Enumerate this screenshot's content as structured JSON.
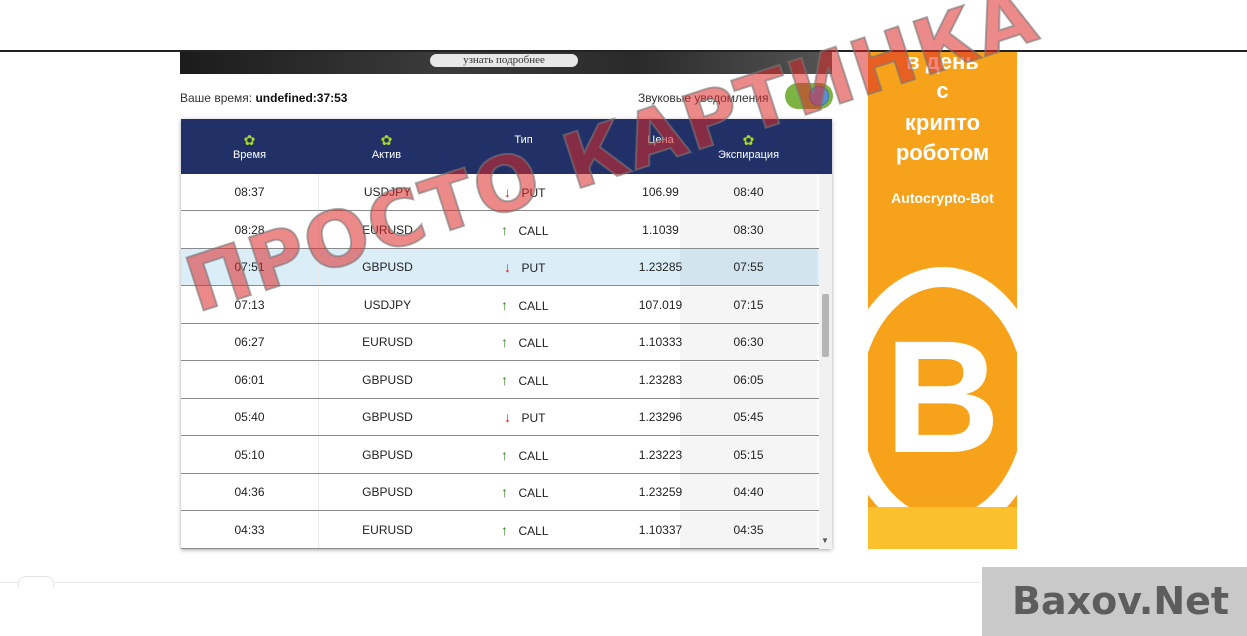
{
  "banner": {
    "button_label": "узнать подробнее"
  },
  "status": {
    "time_prefix": "Ваше время:",
    "time_value": "undefined:37:53",
    "sound_label": "Звуковые уведомления",
    "sound_enabled": true
  },
  "table": {
    "headers": [
      {
        "label": "Время",
        "icon": "gear-icon"
      },
      {
        "label": "Актив",
        "icon": "gear-icon"
      },
      {
        "label": "Тип",
        "icon": ""
      },
      {
        "label": "Цена",
        "icon": ""
      },
      {
        "label": "Экспирация",
        "icon": "gear-icon"
      }
    ],
    "rows": [
      {
        "time": "08:37",
        "asset": "USDJPY",
        "type": "PUT",
        "price": "106.99",
        "expiration": "08:40"
      },
      {
        "time": "08:28",
        "asset": "EURUSD",
        "type": "CALL",
        "price": "1.1039",
        "expiration": "08:30"
      },
      {
        "time": "07:51",
        "asset": "GBPUSD",
        "type": "PUT",
        "price": "1.23285",
        "expiration": "07:55"
      },
      {
        "time": "07:13",
        "asset": "USDJPY",
        "type": "CALL",
        "price": "107.019",
        "expiration": "07:15"
      },
      {
        "time": "06:27",
        "asset": "EURUSD",
        "type": "CALL",
        "price": "1.10333",
        "expiration": "06:30"
      },
      {
        "time": "06:01",
        "asset": "GBPUSD",
        "type": "CALL",
        "price": "1.23283",
        "expiration": "06:05"
      },
      {
        "time": "05:40",
        "asset": "GBPUSD",
        "type": "PUT",
        "price": "1.23296",
        "expiration": "05:45"
      },
      {
        "time": "05:10",
        "asset": "GBPUSD",
        "type": "CALL",
        "price": "1.23223",
        "expiration": "05:15"
      },
      {
        "time": "04:36",
        "asset": "GBPUSD",
        "type": "CALL",
        "price": "1.23259",
        "expiration": "04:40"
      },
      {
        "time": "04:33",
        "asset": "EURUSD",
        "type": "CALL",
        "price": "1.10337",
        "expiration": "04:35"
      }
    ],
    "highlighted_row": 2,
    "colors": {
      "header_bg": "#213168",
      "call": "#2e8b1e",
      "put": "#d71c1c",
      "highlight": "#dbeef8"
    }
  },
  "promo": {
    "lines": [
      "в день",
      "с",
      "крипто",
      "роботом"
    ],
    "bot_name": "Autocrypto-Bot",
    "symbol": "B",
    "colors": {
      "bg": "#f7a21b",
      "coin": "#ffffff"
    }
  },
  "watermarks": {
    "center": "ПРОСТО КАРТИНКА",
    "corner": "Baxov.Net"
  }
}
